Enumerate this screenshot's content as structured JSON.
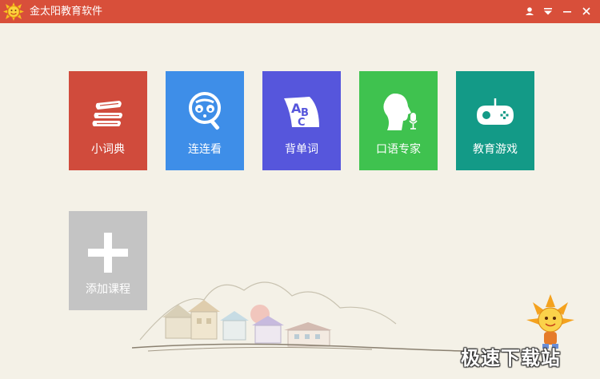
{
  "app": {
    "title": "金太阳教育软件",
    "titlebar_color": "#d84f3a"
  },
  "window_controls": [
    {
      "name": "user-icon"
    },
    {
      "name": "menu-icon"
    },
    {
      "name": "minimize-icon"
    },
    {
      "name": "close-icon"
    }
  ],
  "tiles": [
    {
      "label": "小词典",
      "icon": "books-icon",
      "color": "#d04b3c"
    },
    {
      "label": "连连看",
      "icon": "face-magnifier-icon",
      "color": "#3e8ee8"
    },
    {
      "label": "背单词",
      "icon": "abc-card-icon",
      "color": "#5656dc"
    },
    {
      "label": "口语专家",
      "icon": "speaking-head-icon",
      "color": "#3fc24f"
    },
    {
      "label": "教育游戏",
      "icon": "gamepad-icon",
      "color": "#139a87"
    },
    {
      "label": "添加课程",
      "icon": "plus-icon",
      "color": "#c4c4c4"
    }
  ],
  "watermark": "极速下载站"
}
